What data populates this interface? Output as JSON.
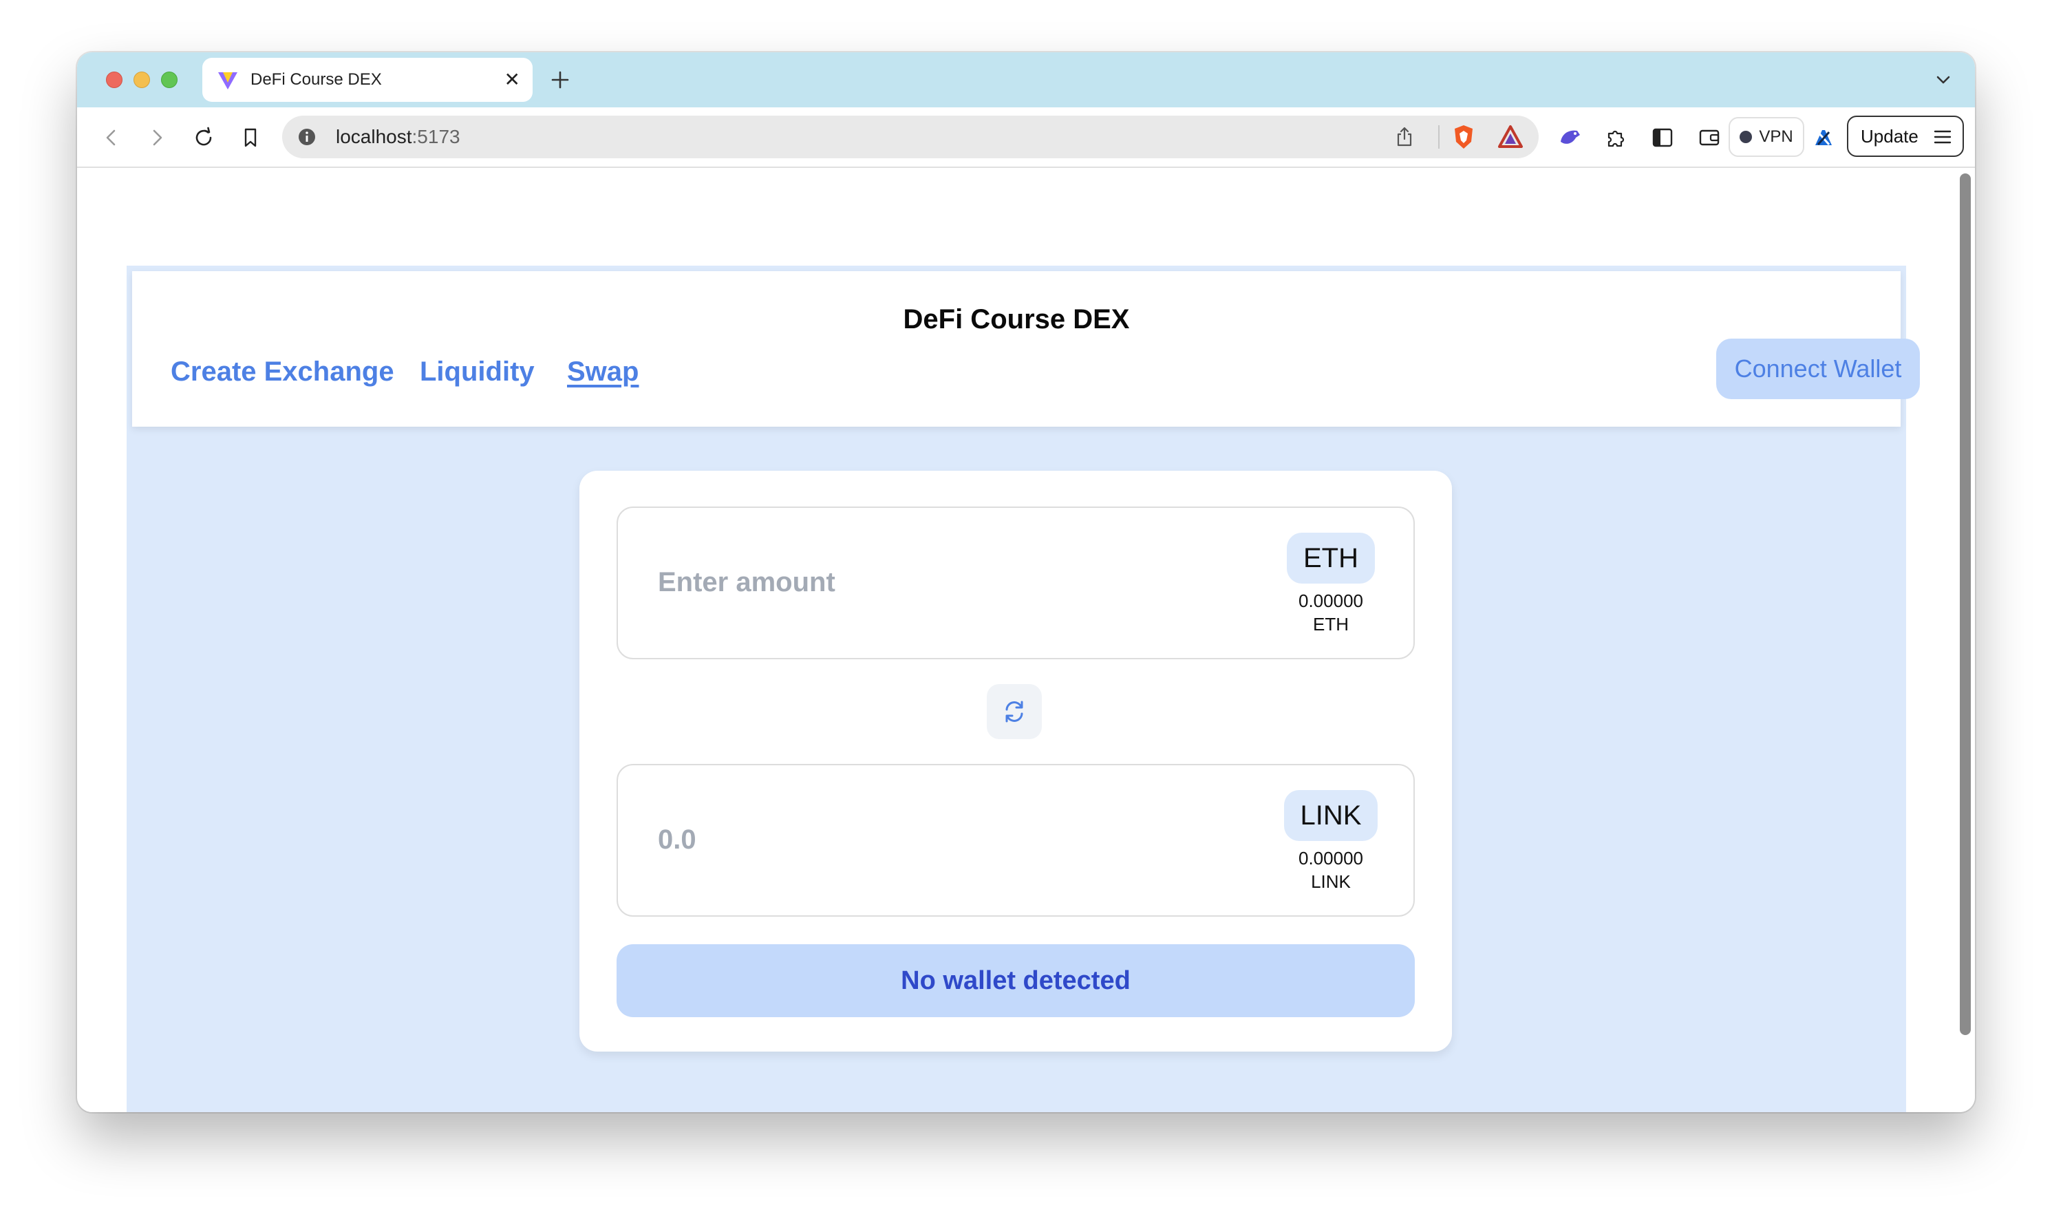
{
  "browser": {
    "tab": {
      "title": "DeFi Course DEX",
      "close_glyph": "✕"
    },
    "new_tab_icon": "plus-icon",
    "address": {
      "host": "localhost",
      "port": ":5173"
    },
    "vpn_label": "VPN",
    "update_label": "Update"
  },
  "app": {
    "title": "DeFi Course DEX",
    "nav": {
      "create_exchange": "Create Exchange",
      "liquidity": "Liquidity",
      "swap": "Swap"
    },
    "connect_wallet": "Connect Wallet"
  },
  "swap": {
    "from": {
      "placeholder": "Enter amount",
      "token": "ETH",
      "balance": "0.00000",
      "balance_symbol": "ETH"
    },
    "to": {
      "placeholder": "0.0",
      "token": "LINK",
      "balance": "0.00000",
      "balance_symbol": "LINK"
    },
    "submit_label": "No wallet detected"
  },
  "colors": {
    "accent": "#4d80e4",
    "app_background": "#dce9fb",
    "button_fill": "#c3d9fb",
    "submit_text": "#2f49c9"
  }
}
